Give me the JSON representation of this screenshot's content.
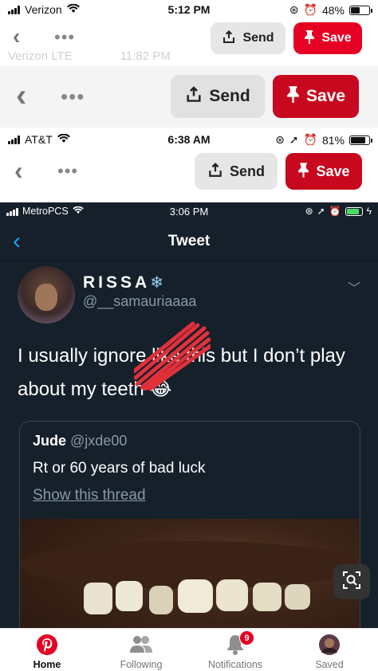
{
  "status1": {
    "carrier": "Verizon",
    "time": "5:12 PM",
    "battery": "48%"
  },
  "toolbar1": {
    "send_label": "Send",
    "save_label": "Save"
  },
  "ghost": {
    "carrier": "Verizon  LTE",
    "time": "11:82 PM"
  },
  "toolbar2": {
    "send_label": "Send",
    "save_label": "Save"
  },
  "status3": {
    "carrier": "AT&T",
    "time": "6:38 AM",
    "battery": "81%"
  },
  "toolbar3": {
    "send_label": "Send",
    "save_label": "Save"
  },
  "tweet": {
    "status": {
      "carrier": "MetroPCS",
      "time": "3:06 PM"
    },
    "nav_title": "Tweet",
    "display_name": "RISSA",
    "handle": "@__samauriaaaa",
    "text": "I usually ignore      like this but I don’t play about my teeth 😂",
    "quote": {
      "name": "Jude",
      "handle": "@jxde00",
      "text": "Rt or 60 years of bad luck",
      "link": "Show this thread"
    }
  },
  "tabbar": {
    "home": "Home",
    "following": "Following",
    "notifications": "Notifications",
    "notifications_badge": "9",
    "saved": "Saved"
  },
  "colors": {
    "pinterest_red": "#e60023",
    "twitter_dark": "#15202b",
    "twitter_blue": "#1da1f2"
  }
}
